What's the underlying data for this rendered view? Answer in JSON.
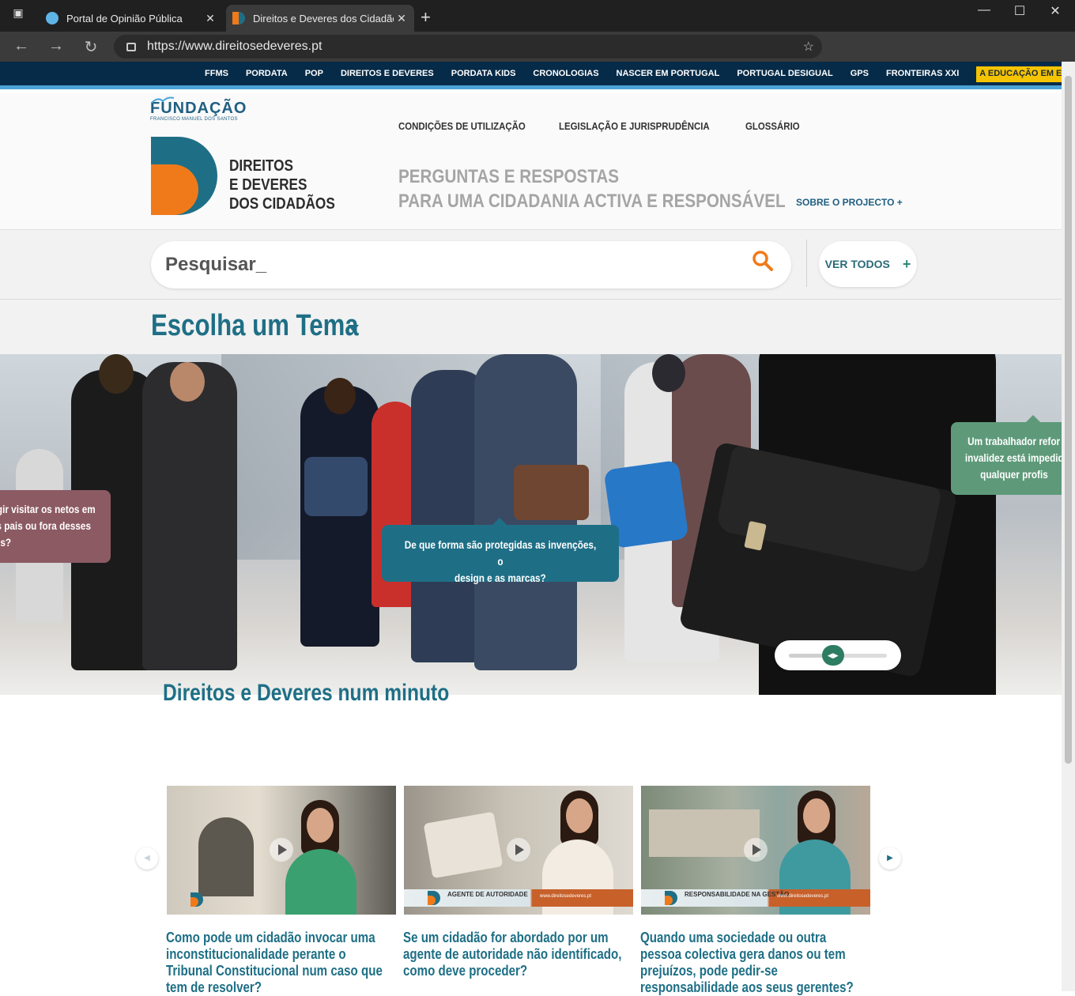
{
  "browser": {
    "tabs": [
      {
        "title": "Portal de Opinião Pública",
        "active": false
      },
      {
        "title": "Direitos e Deveres dos Cidadãos",
        "active": true
      }
    ],
    "url": "https://www.direitosedeveres.pt"
  },
  "topnav": {
    "items": [
      "FFMS",
      "PORDATA",
      "POP",
      "DIREITOS E DEVERES",
      "PORDATA KIDS",
      "CRONOLOGIAS",
      "NASCER EM PORTUGAL",
      "PORTUGAL DESIGUAL",
      "GPS",
      "FRONTEIRAS XXI"
    ],
    "highlight": "A EDUCAÇÃO EM EXAME"
  },
  "header": {
    "fundacao": "FUNDAÇÃO",
    "fundacao_sub": "FRANCISCO MANUEL DOS SANTOS",
    "brand_line1": "DIREITOS",
    "brand_line2": "E DEVERES",
    "brand_line3": "DOS CIDADÃOS",
    "links": [
      "CONDIÇÕES DE UTILIZAÇÃO",
      "LEGISLAÇÃO E JURISPRUDÊNCIA",
      "GLOSSÁRIO"
    ],
    "tagline1": "PERGUNTAS E RESPOSTAS",
    "tagline2": "PARA UMA CIDADANIA ACTIVA E RESPONSÁVEL",
    "sobre": "SOBRE O PROJECTO +"
  },
  "search": {
    "placeholder": "Pesquisar_",
    "ver_todos": "VER TODOS",
    "ver_todos_plus": "+"
  },
  "tema": {
    "title": "Escolha um Tema"
  },
  "hero": {
    "bubble_left_lines": [
      "gir visitar os netos em",
      "s pais ou fora desses",
      "sos?"
    ],
    "bubble_center_lines": [
      "De que forma são protegidas as invenções, o",
      "design e as marcas?"
    ],
    "bubble_right_lines": [
      "Um trabalhador refor",
      "invalidez está impedid",
      "qualquer profis"
    ],
    "slider_position": 0.45
  },
  "minuto": {
    "title": "Direitos e Deveres num minuto",
    "videos": [
      {
        "caption": "Como pode um cidadão invocar uma inconstitucionalidade perante o Tribunal Constitucional num caso que tem de resolver?",
        "lower_third": ""
      },
      {
        "caption": "Se um cidadão for abordado por um agente de autoridade não identificado, como deve proceder?",
        "lower_third": "AGENTE DE AUTORIDADE",
        "site": "www.direitosedeveres.pt"
      },
      {
        "caption": "Quando uma sociedade ou outra pessoa colectiva gera danos ou tem prejuízos, pode pedir-se responsabilidade aos seus gerentes?",
        "lower_third": "RESPONSABILIDADE NA GESTÃO",
        "site": "www.direitosedeveres.pt"
      }
    ]
  },
  "colors": {
    "teal": "#1e6f86",
    "orange": "#f07a1a",
    "navy": "#062b48",
    "yellow": "#f5c400"
  }
}
